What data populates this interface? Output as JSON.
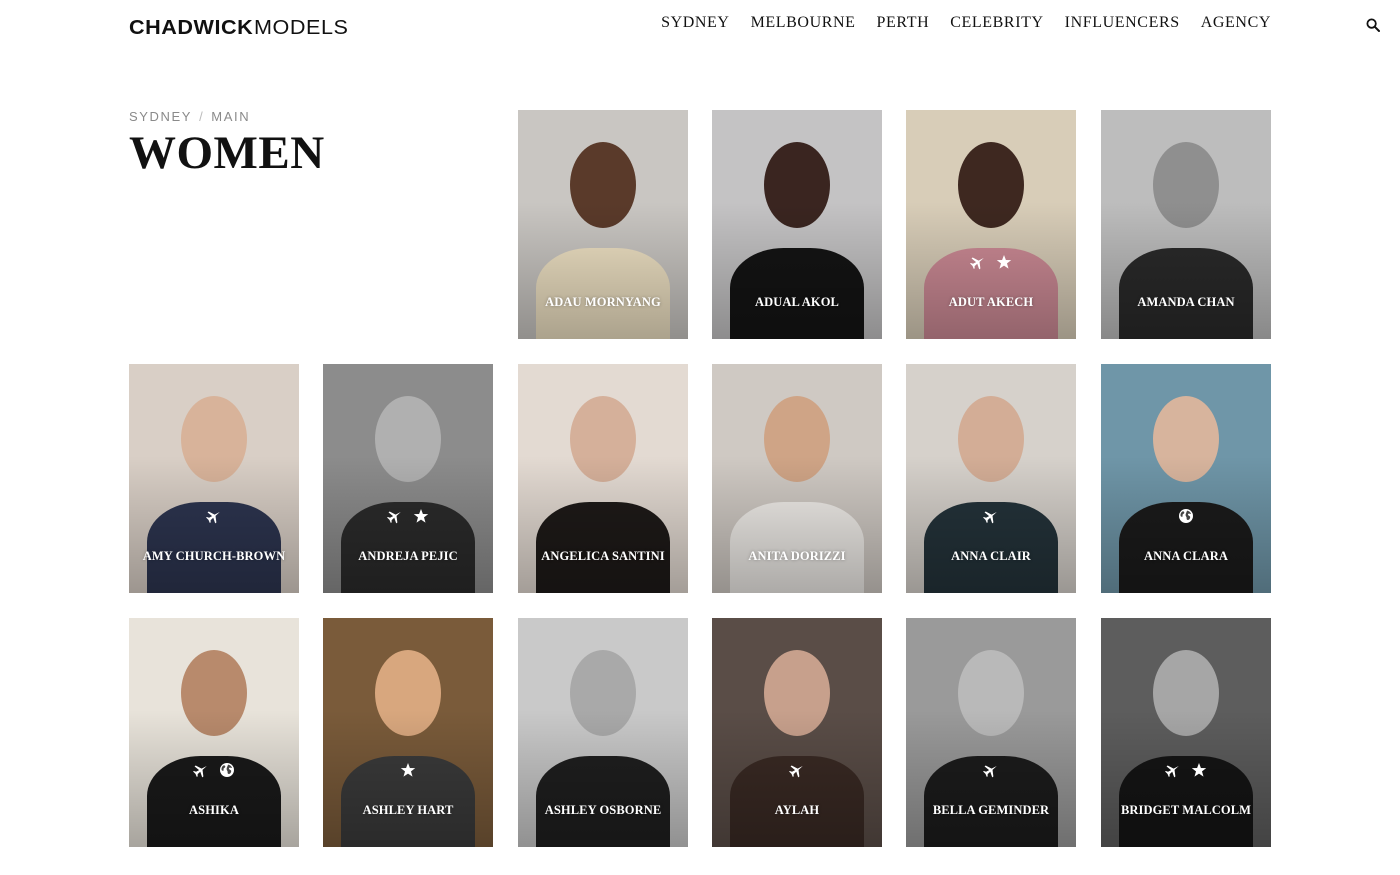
{
  "brand": {
    "bold": "CHADWICK",
    "light": "MODELS"
  },
  "nav": {
    "items": [
      "SYDNEY",
      "MELBOURNE",
      "PERTH",
      "CELEBRITY",
      "INFLUENCERS",
      "AGENCY"
    ],
    "search_icon": "search-icon"
  },
  "breadcrumb": {
    "city": "SYDNEY",
    "separator": "/",
    "board": "MAIN"
  },
  "page_title": "WOMEN",
  "models": [
    {
      "name": "ADAU MORNYANG",
      "icons": [],
      "bg": "#c9c6c2",
      "skin": "#5a3a2a",
      "top": "#eee1c3"
    },
    {
      "name": "ADUAL AKOL",
      "icons": [],
      "bg": "#c4c3c4",
      "skin": "#3a2520",
      "top": "#141414"
    },
    {
      "name": "ADUT AKECH",
      "icons": [
        "plane-icon",
        "star-icon"
      ],
      "bg": "#d8cdb8",
      "skin": "#3e2820",
      "top": "#cc8a95"
    },
    {
      "name": "AMANDA CHAN",
      "icons": [],
      "bg": "#bdbdbd",
      "skin": "#8f8f8f",
      "top": "#2a2a2a"
    },
    {
      "name": "AMY CHURCH-BROWN",
      "icons": [
        "plane-icon"
      ],
      "bg": "#d9cfc6",
      "skin": "#d8b39a",
      "top": "#2d3550"
    },
    {
      "name": "ANDREJA PEJIC",
      "icons": [
        "plane-icon",
        "star-icon"
      ],
      "bg": "#8c8c8c",
      "skin": "#b0b0b0",
      "top": "#2b2b2b"
    },
    {
      "name": "ANGELICA SANTINI",
      "icons": [],
      "bg": "#e3dad2",
      "skin": "#d5b09a",
      "top": "#1e1a18"
    },
    {
      "name": "ANITA DORIZZI",
      "icons": [],
      "bg": "#cfc9c3",
      "skin": "#cfa486",
      "top": "#efece8"
    },
    {
      "name": "ANNA CLAIR",
      "icons": [
        "plane-icon"
      ],
      "bg": "#d6d1cb",
      "skin": "#d3ad96",
      "top": "#24333a"
    },
    {
      "name": "ANNA CLARA",
      "icons": [
        "globe-icon"
      ],
      "bg": "#6f96a8",
      "skin": "#d7b49d",
      "top": "#1b1b1b"
    },
    {
      "name": "ASHIKA",
      "icons": [
        "plane-icon",
        "globe-icon"
      ],
      "bg": "#e8e3da",
      "skin": "#b88a6c",
      "top": "#1a1a1a"
    },
    {
      "name": "ASHLEY HART",
      "icons": [
        "star-icon"
      ],
      "bg": "#7a5b3a",
      "skin": "#d8a77e",
      "top": "#3b3b3b"
    },
    {
      "name": "ASHLEY OSBORNE",
      "icons": [],
      "bg": "#c9c9c9",
      "skin": "#a9a9a9",
      "top": "#1f1f1f"
    },
    {
      "name": "AYLAH",
      "icons": [
        "plane-icon"
      ],
      "bg": "#5a4d47",
      "skin": "#c7a08c",
      "top": "#3a2a24"
    },
    {
      "name": "BELLA GEMINDER",
      "icons": [
        "plane-icon"
      ],
      "bg": "#9a9a9a",
      "skin": "#b9b9b9",
      "top": "#1c1c1c"
    },
    {
      "name": "BRIDGET MALCOLM",
      "icons": [
        "plane-icon",
        "star-icon"
      ],
      "bg": "#5d5d5d",
      "skin": "#a6a6a6",
      "top": "#151515"
    }
  ]
}
